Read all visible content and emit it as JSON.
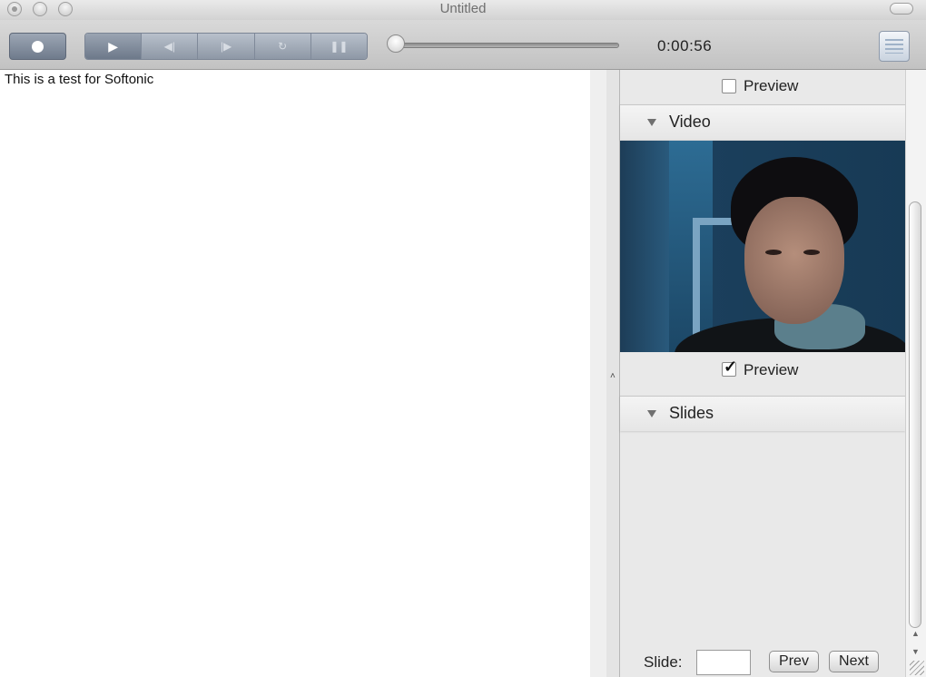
{
  "window": {
    "title": "Untitled"
  },
  "toolbar": {
    "timecode": "0:00:56",
    "transport": [
      "play-icon",
      "rewind-icon",
      "fast-forward-icon",
      "loop-icon",
      "pause-icon"
    ],
    "playback_progress": 0.02
  },
  "editor": {
    "text": "This is a test for Softonic"
  },
  "panel": {
    "top_preview": {
      "label": "Preview",
      "checked": false
    },
    "video": {
      "title": "Video",
      "preview_label": "Preview",
      "preview_checked": true
    },
    "slides": {
      "title": "Slides",
      "slide_label": "Slide:",
      "slide_value": "",
      "prev_label": "Prev",
      "next_label": "Next"
    }
  }
}
